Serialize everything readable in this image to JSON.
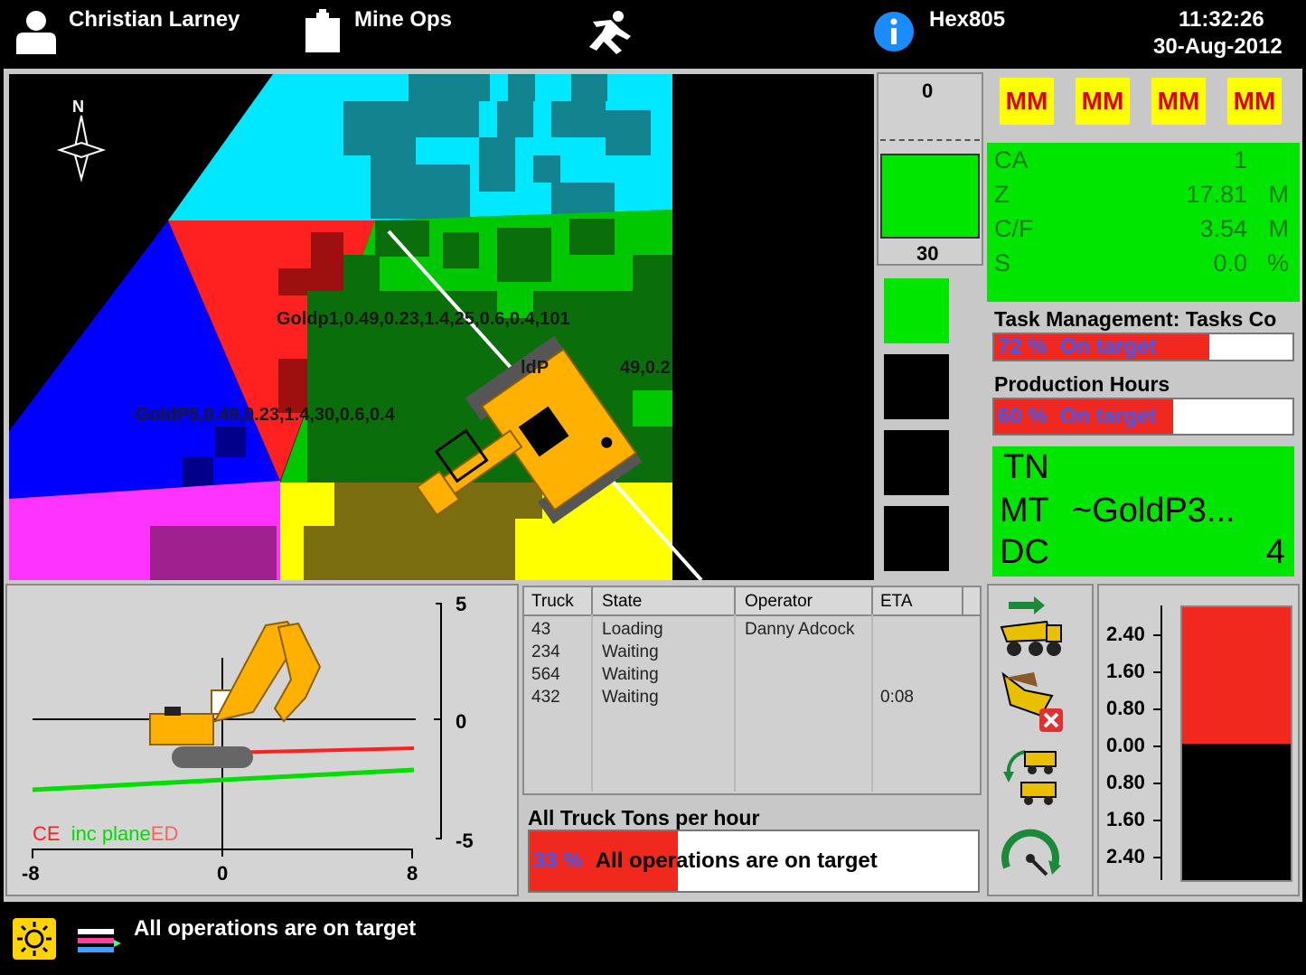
{
  "header": {
    "user_name": "Christian Larney",
    "site_name": "Mine Ops",
    "machine_id": "Hex805",
    "time": "11:32:26",
    "date": "30-Aug-2012"
  },
  "map": {
    "compass_label": "N",
    "block_labels": [
      "Goldp1,0.49,0.23,1.4,25,0.6,0.4,101",
      "GoldP5,0.49,0.23,1.4,30,0.6,0.4",
      "ldP",
      "49,0.2"
    ]
  },
  "depth_scale": {
    "top": "0",
    "bottom": "30",
    "fill_fraction": 0.55
  },
  "mm_buttons": [
    "MM",
    "MM",
    "MM",
    "MM"
  ],
  "position_status": {
    "rows": [
      {
        "key": "CA",
        "value": "1",
        "unit": ""
      },
      {
        "key": "Z",
        "value": "17.81",
        "unit": "M"
      },
      {
        "key": "C/F",
        "value": "3.54",
        "unit": "M"
      },
      {
        "key": "S",
        "value": "0.0",
        "unit": "%"
      }
    ]
  },
  "task_management": {
    "title": "Task Management: Tasks Co",
    "percent": "72 %",
    "message": "On target",
    "fraction": 0.72
  },
  "production_hours": {
    "title": "Production Hours",
    "percent": "60 %",
    "message": "On target",
    "fraction": 0.6
  },
  "material": {
    "rows": [
      {
        "key": "TN",
        "value": ""
      },
      {
        "key": "MT",
        "value": "~GoldP3..."
      },
      {
        "key": "DC",
        "value": "4"
      }
    ]
  },
  "profile_view": {
    "y_ticks": [
      "5",
      "0",
      "-5"
    ],
    "x_ticks": [
      "-8",
      "0",
      "8"
    ],
    "legend_ce": "CE",
    "legend_inc": "inc plane",
    "legend_ed": "ED"
  },
  "truck_table": {
    "columns": [
      "Truck",
      "State",
      "Operator",
      "ETA"
    ],
    "rows": [
      [
        "43",
        "Loading",
        "Danny Adcock",
        ""
      ],
      [
        "234",
        "Waiting",
        "",
        ""
      ],
      [
        "564",
        "Waiting",
        "",
        ""
      ],
      [
        "432",
        "Waiting",
        "",
        "0:08"
      ]
    ]
  },
  "truck_tons": {
    "title": "All Truck Tons per hour",
    "percent": "33 %",
    "message": "All operations are on target",
    "fraction": 0.33
  },
  "side_icons": [
    "truck-dispatch-icon",
    "truck-cancel-icon",
    "truck-swap-icon",
    "speed-gauge-icon"
  ],
  "elevation_gauge": {
    "ticks": [
      "2.40",
      "1.60",
      "0.80",
      "0.00",
      "0.80",
      "1.60",
      "2.40"
    ],
    "upper_fill": 0.5,
    "colors": {
      "upper": "#f0281e",
      "lower": "#000000"
    }
  },
  "footer": {
    "status_text": "All operations are on target"
  },
  "colors": {
    "status_green": "#00e600",
    "alert_red": "#f0281e",
    "mm_yellow": "#ffff00"
  }
}
